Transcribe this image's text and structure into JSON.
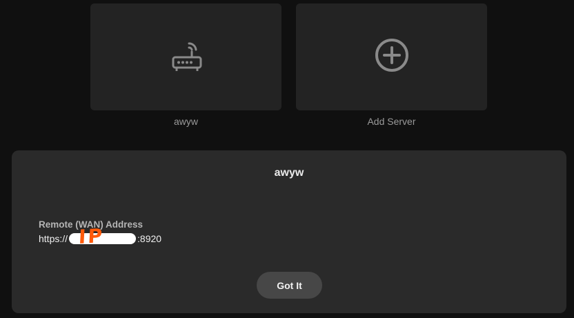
{
  "servers": [
    {
      "name": "awyw",
      "icon": "router-icon"
    },
    {
      "name": "Add Server",
      "icon": "plus-circle-icon"
    }
  ],
  "dialog": {
    "title": "awyw",
    "address_label": "Remote (WAN) Address",
    "address_prefix": "https://",
    "redaction_text": "IP",
    "address_suffix": ":8920",
    "confirm_label": "Got It"
  },
  "colors": {
    "background": "#101010",
    "card": "#232323",
    "dialog": "#2a2a2a",
    "button": "#474747",
    "icon": "#8a8a8a",
    "redaction_annotation": "#ff5a0a"
  }
}
